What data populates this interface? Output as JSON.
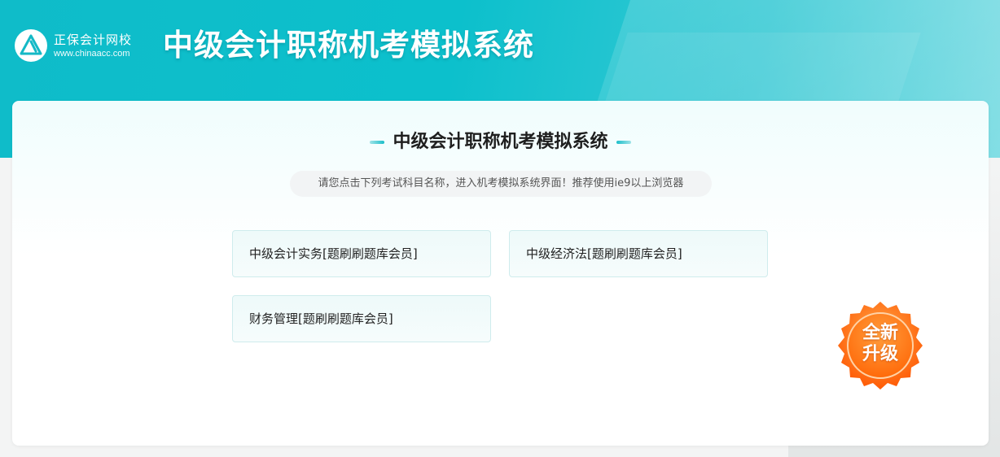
{
  "header": {
    "logo_name": "正保会计网校",
    "logo_url": "www.chinaacc.com",
    "title": "中级会计职称机考模拟系统"
  },
  "main": {
    "title": "中级会计职称机考模拟系统",
    "hint": "请您点击下列考试科目名称，进入机考模拟系统界面！推荐使用ie9以上浏览器",
    "exams": [
      {
        "label": "中级会计实务[题刷刷题库会员]"
      },
      {
        "label": "中级经济法[题刷刷题库会员]"
      },
      {
        "label": "财务管理[题刷刷题库会员]"
      }
    ]
  },
  "badge": {
    "line1": "全新",
    "line2": "升级"
  },
  "colors": {
    "brand": "#0cc0cc",
    "badge": "#ff6a0a"
  }
}
